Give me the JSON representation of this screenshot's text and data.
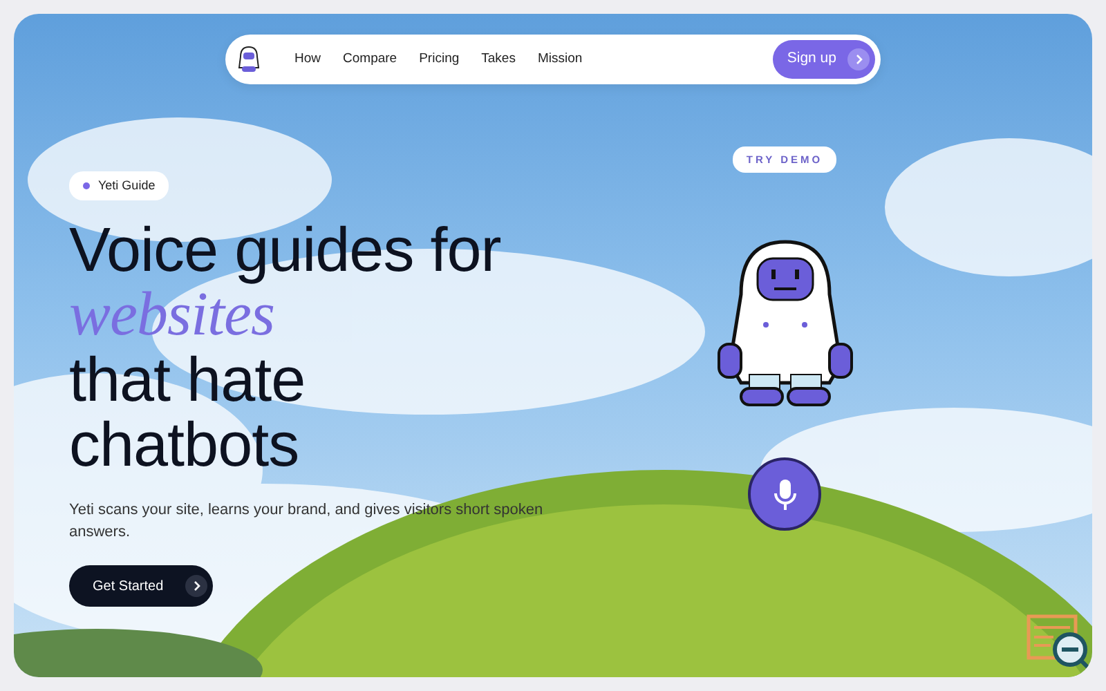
{
  "nav": {
    "links": [
      "How",
      "Compare",
      "Pricing",
      "Takes",
      "Mission"
    ],
    "cta": "Sign up"
  },
  "hero": {
    "badge": "Yeti Guide",
    "headline": [
      {
        "text": "Voice guides for",
        "kind": "plain"
      },
      {
        "text": "websites",
        "kind": "accent"
      },
      {
        "text": "that hate",
        "kind": "plain"
      },
      {
        "text": "chatbots",
        "kind": "plain"
      }
    ],
    "description": "Yeti scans your site, learns your brand, and gives visitors short spoken answers.",
    "button": "Get Started"
  },
  "demo": {
    "label": "TRY DEMO"
  }
}
